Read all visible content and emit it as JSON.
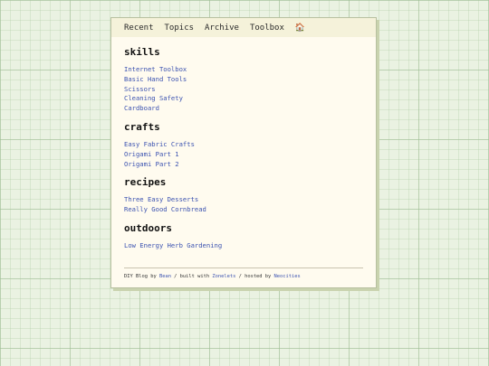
{
  "nav": {
    "items": [
      "Recent",
      "Topics",
      "Archive",
      "Toolbox"
    ],
    "home_icon": "home-icon"
  },
  "sections": [
    {
      "title": "skills",
      "links": [
        "Internet Toolbox",
        "Basic Hand Tools",
        "Scissors",
        "Cleaning Safety",
        "Cardboard"
      ]
    },
    {
      "title": "crafts",
      "links": [
        "Easy Fabric Crafts",
        "Origami Part 1",
        "Origami Part 2"
      ]
    },
    {
      "title": "recipes",
      "links": [
        "Three Easy Desserts",
        "Really Good Cornbread"
      ]
    },
    {
      "title": "outdoors",
      "links": [
        "Low Energy Herb Gardening"
      ]
    }
  ],
  "footer": {
    "prefix": "DIY Blog by ",
    "author": "Bean",
    "built_text": " / built with ",
    "builder": "Zonelets",
    "hosted_text": " / hosted by ",
    "host": "Neocities"
  },
  "colors": {
    "link": "#3b52b0",
    "card_bg": "#fffbef",
    "nav_bg": "#f5f2da",
    "page_bg": "#eaf2e2"
  }
}
